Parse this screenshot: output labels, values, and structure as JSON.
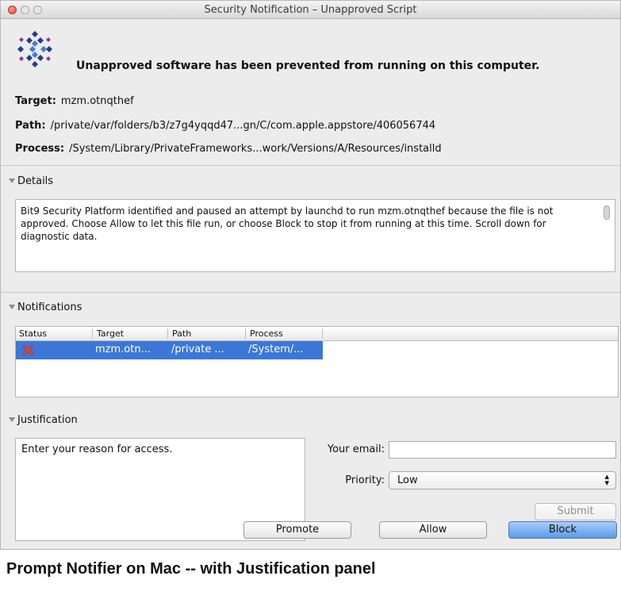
{
  "window": {
    "title": "Security Notification – Unapproved Script"
  },
  "header": {
    "headline": "Unapproved software has been prevented from running on this computer.",
    "target_label": "Target:",
    "target_value": "mzm.otnqthef",
    "path_label": "Path:",
    "path_value": "/private/var/folders/b3/z7g4yqqd47...gn/C/com.apple.appstore/406056744",
    "process_label": "Process:",
    "process_value": "/System/Library/PrivateFrameworks...work/Versions/A/Resources/installd"
  },
  "details": {
    "title": "Details",
    "text": "Bit9 Security Platform identified and paused an attempt by launchd to run mzm.otnqthef because the file is not approved.  Choose Allow to let this file run, or choose Block to stop it from running at this time. Scroll down for diagnostic data."
  },
  "notifications": {
    "title": "Notifications",
    "columns": [
      "Status",
      "Target",
      "Path",
      "Process"
    ],
    "rows": [
      {
        "status_icon": "red-x-icon",
        "target": "mzm.otn...",
        "path": "/private ...",
        "process": "/System/..."
      }
    ]
  },
  "justification": {
    "title": "Justification",
    "reason_placeholder": "Enter your reason for access.",
    "email_label": "Your email:",
    "email_value": "",
    "priority_label": "Priority:",
    "priority_value": "Low",
    "submit_label": "Submit"
  },
  "buttons": {
    "promote": "Promote",
    "allow": "Allow",
    "block": "Block"
  },
  "caption": "Prompt Notifier on Mac -- with Justification panel",
  "colors": {
    "selection": "#3c77d8",
    "primary_button": "#5a9ae8",
    "error": "#e0443a"
  }
}
